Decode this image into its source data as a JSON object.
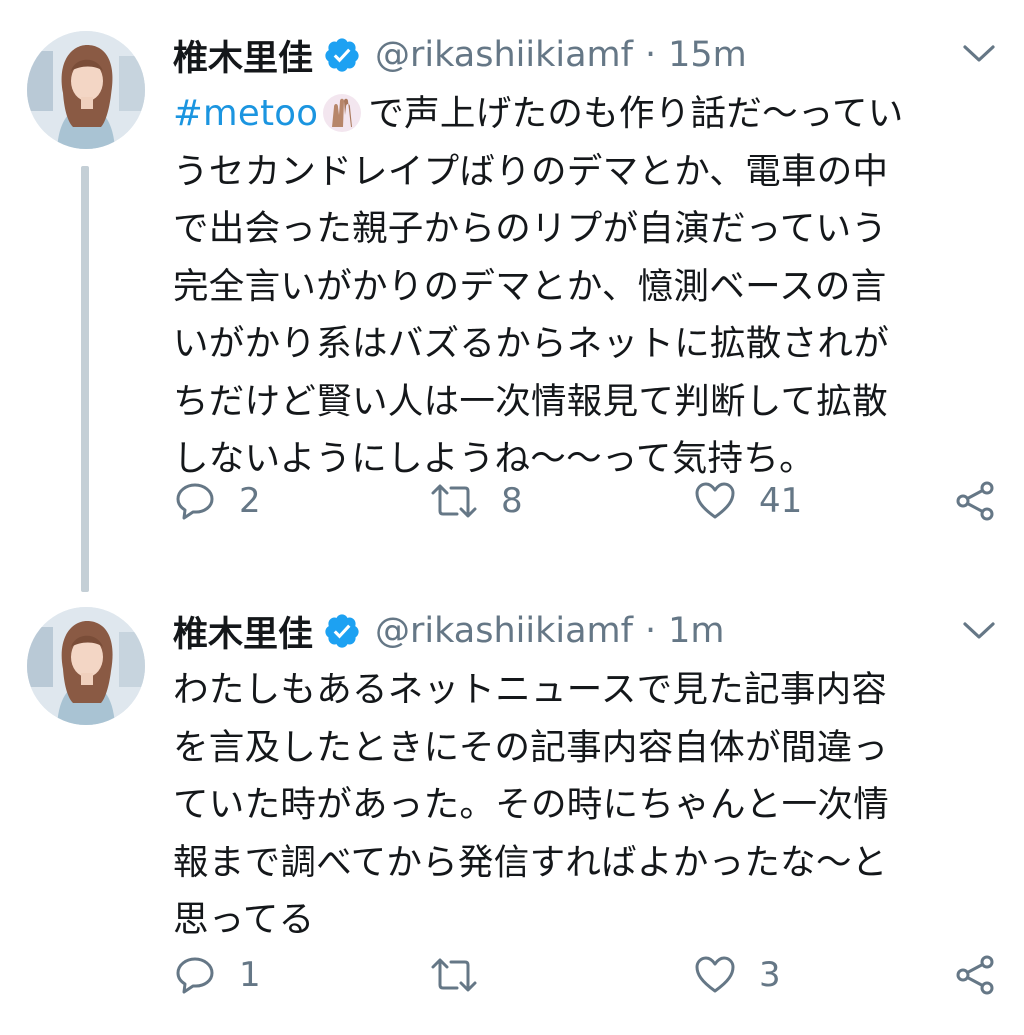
{
  "colors": {
    "accent": "#1b95e0",
    "secondary_text": "#657786",
    "thread_line": "#c4cfd6",
    "verified": "#1da1f2"
  },
  "tweets": [
    {
      "display_name": "椎木里佳",
      "verified": true,
      "handle": "@rikashiikiamf",
      "separator": "·",
      "time": "15m",
      "hashtag": "#metoo",
      "emoji": "raised-hands-icon",
      "lines": [
        "で声上げたのも作り話だ〜ってい",
        "うセカンドレイプばりのデマとか、電車の中",
        "で出会った親子からのリプが自演だっていう",
        "完全言いがかりのデマとか、憶測ベースの言",
        "いがかり系はバズるからネットに拡散されが",
        "ちだけど賢い人は一次情報見て判断して拡散",
        "しないようにしようね〜〜って気持ち。"
      ],
      "reply_count": "2",
      "retweet_count": "8",
      "like_count": "41"
    },
    {
      "display_name": "椎木里佳",
      "verified": true,
      "handle": "@rikashiikiamf",
      "separator": "·",
      "time": "1m",
      "lines": [
        "わたしもあるネットニュースで見た記事内容",
        "を言及したときにその記事内容自体が間違っ",
        "ていた時があった。その時にちゃんと一次情",
        "報まで調べてから発信すればよかったな〜と",
        "思ってる"
      ],
      "reply_count": "1",
      "retweet_count": "",
      "like_count": "3"
    }
  ]
}
